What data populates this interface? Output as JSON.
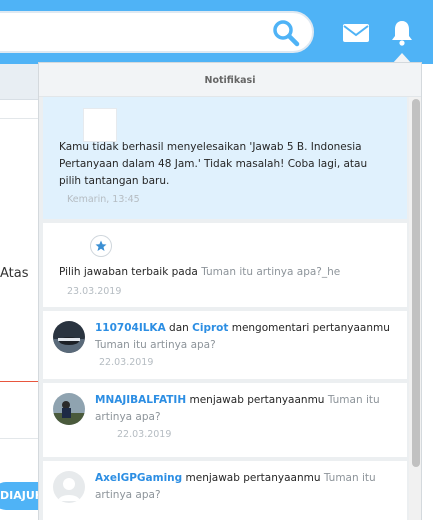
{
  "header": {
    "search_placeholder": ""
  },
  "background_page": {
    "partial_text": "Atas",
    "button_label": "DIAJUK"
  },
  "notifications": {
    "title": "Notifikasi",
    "items": [
      {
        "text": "Kamu tidak berhasil menyelesaikan 'Jawab 5 B. Indonesia Pertanyaan dalam 48 Jam.' Tidak masalah! Coba lagi, atau pilih tantangan baru.",
        "time": "Kemarin, 13:45"
      },
      {
        "text": "Pilih jawaban terbaik pada ",
        "question": "Tuman itu artinya apa?_he",
        "time": "23.03.2019"
      },
      {
        "user1": "110704ILKA",
        "connector": " dan ",
        "user2": "Ciprot",
        "action": " mengomentari pertanyaanmu ",
        "question": "Tuman itu artinya apa?",
        "time": "22.03.2019"
      },
      {
        "user": "MNAJIBALFATIH",
        "action": " menjawab pertanyaanmu ",
        "question": "Tuman itu artinya apa?",
        "time": "22.03.2019"
      },
      {
        "user": "AxelGPGaming",
        "action": " menjawab pertanyaanmu ",
        "question": "Tuman itu artinya apa?"
      }
    ]
  },
  "colors": {
    "brand_blue": "#4fb3f6",
    "link_blue": "#2c8ee3",
    "highlight_bg": "#e0f1fd",
    "accent_red": "#e8563e"
  }
}
